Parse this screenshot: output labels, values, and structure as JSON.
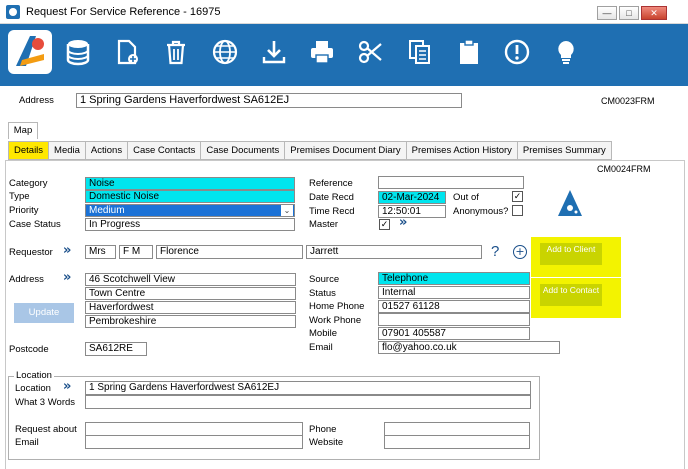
{
  "window": {
    "title": "Request For Service Reference - 16975",
    "minimize": "—",
    "maximize": "□",
    "close": "✕"
  },
  "toolbar": {
    "icons": [
      "database-icon",
      "new-document-icon",
      "trash-icon",
      "globe-icon",
      "download-icon",
      "print-icon",
      "scissors-icon",
      "copy-icon",
      "clipboard-icon",
      "alert-icon",
      "lightbulb-icon"
    ]
  },
  "header": {
    "address_label": "Address",
    "address_value": "1 Spring Gardens Haverfordwest SA612EJ",
    "form_code": "CM0023FRM",
    "map_tab": "Map"
  },
  "tabs": [
    "Details",
    "Media",
    "Actions",
    "Case Contacts",
    "Case Documents",
    "Premises Document Diary",
    "Premises Action History",
    "Premises Summary"
  ],
  "details": {
    "form_code": "CM0024FRM",
    "category_label": "Category",
    "category_value": "Noise",
    "type_label": "Type",
    "type_value": "Domestic Noise",
    "priority_label": "Priority",
    "priority_value": "Medium",
    "case_status_label": "Case Status",
    "case_status_value": "In Progress",
    "reference_label": "Reference",
    "reference_value": "",
    "date_recd_label": "Date Recd",
    "date_recd_value": "02-Mar-2024",
    "time_recd_label": "Time Recd",
    "time_recd_value": "12:50:01",
    "master_label": "Master",
    "out_of_label": "Out of",
    "anonymous_label": "Anonymous?",
    "requestor_label": "Requestor",
    "title_value": "Mrs",
    "initials_value": "F M",
    "forename_value": "Florence",
    "surname_value": "Jarrett",
    "help_glyph": "?",
    "add_glyph": "+",
    "add_to_client": "Add to Client",
    "add_to_contact": "Add to Contact",
    "address_label": "Address",
    "address_lines": [
      "46 Scotchwell View",
      "Town Centre",
      "Haverfordwest",
      "Pembrokeshire"
    ],
    "update_button": "Update",
    "postcode_label": "Postcode",
    "postcode_value": "SA612RE",
    "source_label": "Source",
    "source_value": "Telephone",
    "status_label": "Status",
    "status_value": "Internal",
    "home_phone_label": "Home Phone",
    "home_phone_value": "01527 61128",
    "work_phone_label": "Work Phone",
    "work_phone_value": "",
    "mobile_label": "Mobile",
    "mobile_value": "07901 405587",
    "email_label": "Email",
    "email_value": "flo@yahoo.co.uk"
  },
  "location": {
    "group_title": "Location",
    "location_label": "Location",
    "location_value": "1 Spring Gardens Haverfordwest SA612EJ",
    "what3words_label": "What 3 Words",
    "request_about_label": "Request about",
    "email_label": "Email",
    "phone_label": "Phone",
    "website_label": "Website"
  },
  "colors": {
    "toolbar": "#1f6fb2",
    "active_tab": "#ffe800",
    "cyan_field": "#00e5ee",
    "highlight": "#f3f300"
  }
}
